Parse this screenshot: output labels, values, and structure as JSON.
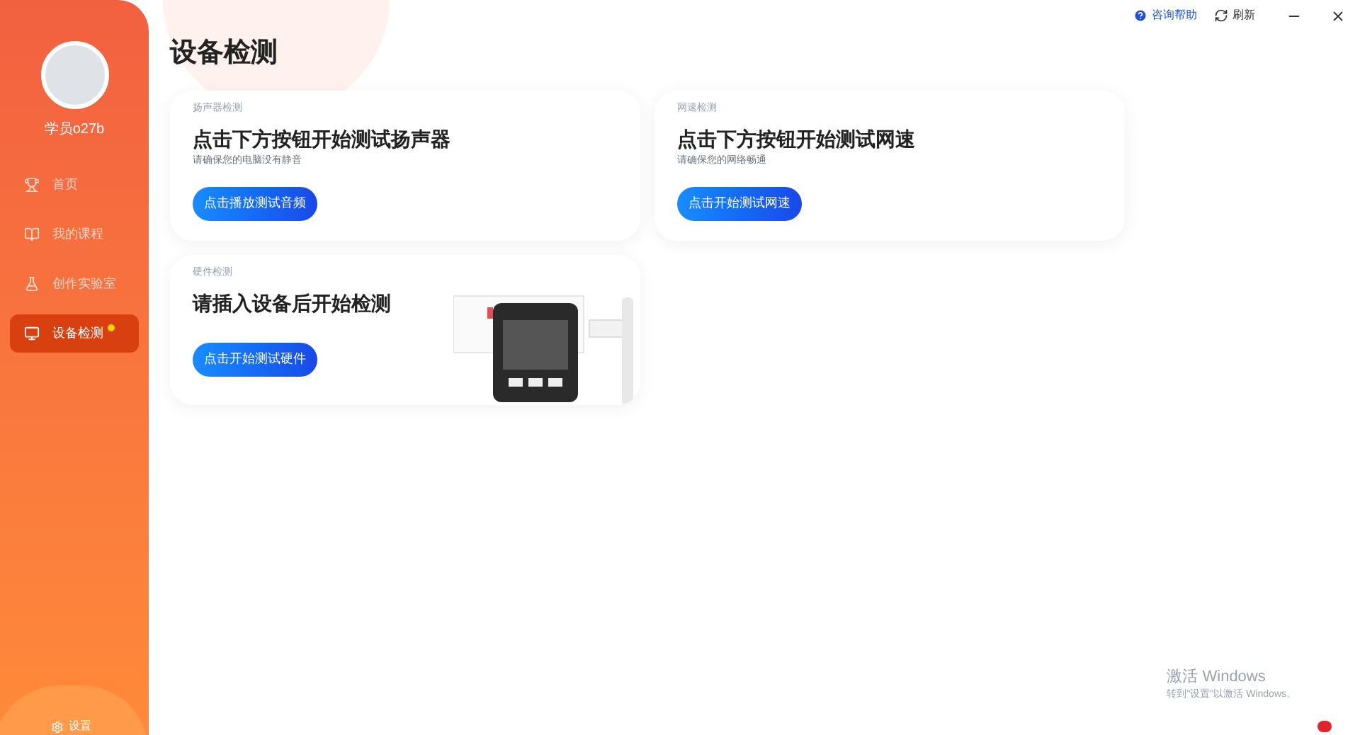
{
  "user": {
    "name": "学员o27b"
  },
  "nav": [
    {
      "label": "首页",
      "selected": false,
      "dot": false
    },
    {
      "label": "我的课程",
      "selected": false,
      "dot": false
    },
    {
      "label": "创作实验室",
      "selected": false,
      "dot": false
    },
    {
      "label": "设备检测",
      "selected": true,
      "dot": true
    }
  ],
  "sidebar_footer": {
    "label": "设置"
  },
  "title_bar": {
    "help": "咨询帮助",
    "refresh": "刷新"
  },
  "page_title": "设备检测",
  "cards": [
    {
      "kind": "speaker",
      "tag": "扬声器检测",
      "heading": "点击下方按钮开始测试扬声器",
      "hint": "请确保您的电脑没有静音",
      "button": "点击播放测试音频"
    },
    {
      "kind": "network",
      "tag": "网速检测",
      "heading": "点击下方按钮开始测试网速",
      "hint": "请确保您的网络畅通",
      "button": "点击开始测试网速"
    },
    {
      "kind": "hardware",
      "tag": "硬件检测",
      "heading": "请插入设备后开始检测",
      "button": "点击开始测试硬件"
    }
  ],
  "os_notice": {
    "title": "激活 Windows",
    "text": "转到\"设置\"以激活 Windows。"
  }
}
